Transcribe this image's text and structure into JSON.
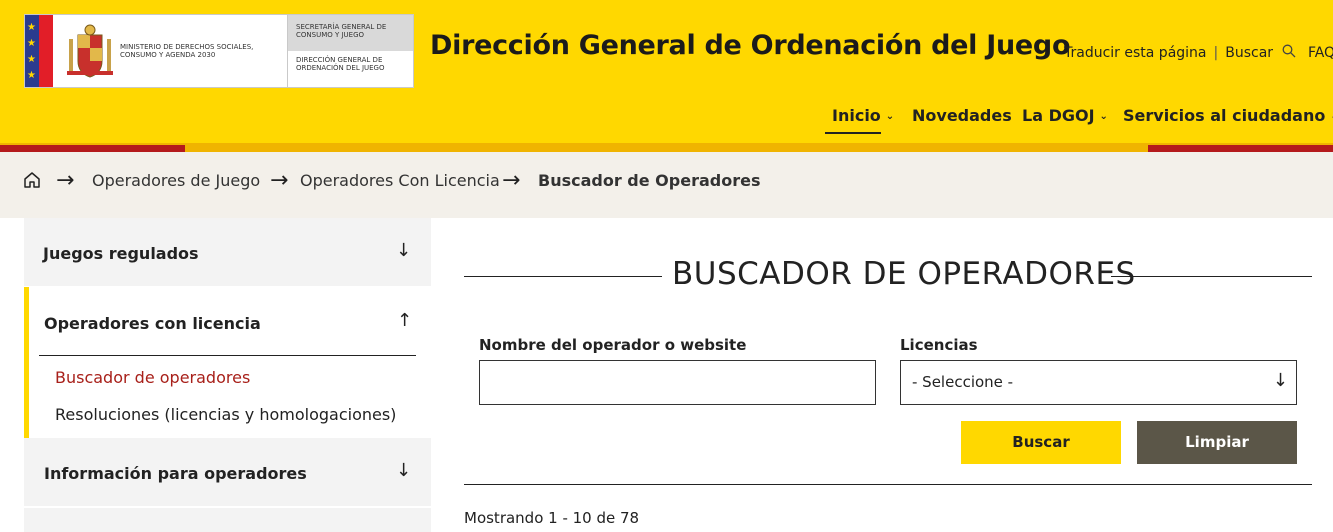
{
  "header": {
    "logo": {
      "ministry": "MINISTERIO DE DERECHOS SOCIALES, CONSUMO Y AGENDA 2030",
      "secretaria": "SECRETARÍA GENERAL DE CONSUMO Y JUEGO",
      "direccion": "DIRECCIÓN GENERAL DE ORDENACIÓN DEL JUEGO"
    },
    "title": "Dirección General de Ordenación del Juego",
    "top_links": {
      "translate": "Traducir esta página",
      "separator": "|",
      "search": "Buscar",
      "faq": "FAQ"
    },
    "nav": [
      {
        "label": "Inicio",
        "has_dropdown": true,
        "active": true
      },
      {
        "label": "Novedades",
        "has_dropdown": false
      },
      {
        "label": "La DGOJ",
        "has_dropdown": true
      },
      {
        "label": "Servicios al ciudadano",
        "has_dropdown": true
      }
    ],
    "colors": {
      "brand_yellow": "#FFD800",
      "brand_red": "#B41A1C",
      "stripe_orange": "#F0B400"
    }
  },
  "breadcrumb": {
    "items": [
      "Operadores de Juego",
      "Operadores Con Licencia"
    ],
    "current": "Buscador de Operadores"
  },
  "sidebar": {
    "sections": [
      {
        "label": "Juegos regulados",
        "expanded": false
      },
      {
        "label": "Operadores con licencia",
        "expanded": true,
        "items": [
          {
            "label": "Buscador de operadores",
            "active": true
          },
          {
            "label": "Resoluciones (licencias y homologaciones)",
            "active": false
          }
        ]
      },
      {
        "label": "Información para operadores",
        "expanded": false
      }
    ]
  },
  "main": {
    "title": "BUSCADOR DE OPERADORES",
    "form": {
      "operator_label": "Nombre del operador o website",
      "operator_value": "",
      "licencias_label": "Licencias",
      "licencias_selected": "- Seleccione -",
      "buscar_label": "Buscar",
      "limpiar_label": "Limpiar"
    },
    "results_text": "Mostrando 1 - 10 de 78"
  },
  "colors": {
    "active_link": "#A8201A",
    "limpiar_bg": "#5B5648"
  }
}
